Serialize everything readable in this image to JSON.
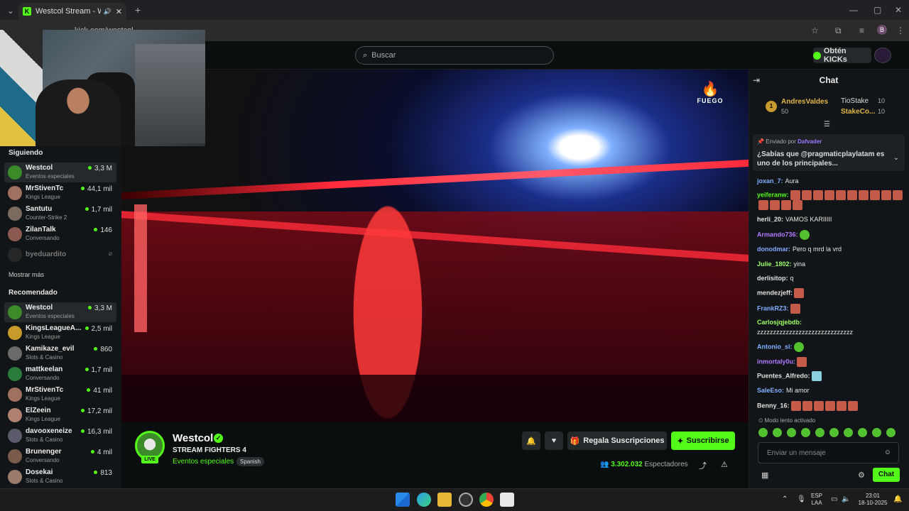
{
  "browser": {
    "tab_title": "Westcol Stream - Watch Li",
    "tab_favicon": "K",
    "url": "kick.com/westcol",
    "profile_initial": "B"
  },
  "header": {
    "search_placeholder": "Buscar",
    "kicks_button": "Obtén KICKs"
  },
  "sidebar": {
    "following_title": "Siguiendo",
    "following": [
      {
        "name": "Westcol",
        "category": "Eventos especiales",
        "viewers": "3,3 M"
      },
      {
        "name": "MrStivenTc",
        "category": "Kings League",
        "viewers": "44,1 mil"
      },
      {
        "name": "Santutu",
        "category": "Counter-Strike 2",
        "viewers": "1,7 mil"
      },
      {
        "name": "ZilanTalk",
        "category": "Conversando",
        "viewers": "146"
      },
      {
        "name": "byeduardito",
        "category": "",
        "viewers": ""
      }
    ],
    "show_more": "Mostrar más",
    "recommended_title": "Recomendado",
    "recommended": [
      {
        "name": "Westcol",
        "category": "Eventos especiales",
        "viewers": "3,3 M"
      },
      {
        "name": "KingsLeagueA...",
        "category": "Kings League",
        "viewers": "2,5 mil"
      },
      {
        "name": "Kamikaze_evil",
        "category": "Slots & Casino",
        "viewers": "860"
      },
      {
        "name": "mattkeelan",
        "category": "Conversando",
        "viewers": "1,7 mil"
      },
      {
        "name": "MrStivenTc",
        "category": "Kings League",
        "viewers": "41 mil"
      },
      {
        "name": "ElZeein",
        "category": "Kings League",
        "viewers": "17,2 mil"
      },
      {
        "name": "davooxeneize",
        "category": "Slots & Casino",
        "viewers": "16,3 mil"
      },
      {
        "name": "Brunenger",
        "category": "Conversando",
        "viewers": "4 mil"
      },
      {
        "name": "Dosekai",
        "category": "Slots & Casino",
        "viewers": "813"
      }
    ]
  },
  "video": {
    "watermark": "FUEGO"
  },
  "stream": {
    "streamer": "Westcol",
    "live_badge": "LIVE",
    "title": "STREAM FIGHTERS 4",
    "category": "Eventos especiales",
    "language": "Spanish",
    "gift_button": "Regala Suscripciones",
    "subscribe_button": "Suscribirse",
    "viewer_count": "3.302.032",
    "viewer_label": "Espectadores"
  },
  "chat": {
    "title": "Chat",
    "leaderboard": [
      {
        "rank": "1",
        "name": "AndresValdes",
        "value": "50"
      },
      {
        "name": "TioStake",
        "value": "10"
      },
      {
        "name": "StakeCo...",
        "value": "10"
      }
    ],
    "pinned_by_label": "Enviado por",
    "pinned_by_user": "Dafvader",
    "pinned_message": "¿Sabías que @pragmaticplaylatam es uno de los principales...",
    "messages": [
      {
        "user": "joxan_7:",
        "text": "Aura",
        "color": "#7fb0ff"
      },
      {
        "user": "yeiferanw:",
        "text": "",
        "color": "#53fc18"
      },
      {
        "user": "herli_20:",
        "text": "VAMOS KARIIIII",
        "color": "#e0e0e0"
      },
      {
        "user": "Armando736:",
        "text": "",
        "color": "#b07bff"
      },
      {
        "user": "donodmar:",
        "text": "Pero q mrd la vrd",
        "color": "#7fa8ff"
      },
      {
        "user": "Julie_1802:",
        "text": "yina",
        "color": "#9bff6a"
      },
      {
        "user": "derlisitop:",
        "text": "q",
        "color": "#e0e0e0"
      },
      {
        "user": "mendezjeff:",
        "text": "",
        "color": "#e0e0e0"
      },
      {
        "user": "FrankRZ3:",
        "text": "",
        "color": "#7fb0ff"
      },
      {
        "user": "Carlosjqjebdb:",
        "text": "",
        "color": "#9bff6a"
      },
      {
        "user": "",
        "text": "zzzzzzzzzzzzzzzzzzzzzzzzzzzzzz",
        "color": "#e0e0e0"
      },
      {
        "user": "Antonio_si:",
        "text": "",
        "color": "#7fb0ff"
      },
      {
        "user": "inmortaly0u:",
        "text": "",
        "color": "#b07bff"
      },
      {
        "user": "Puentes_Alfredo:",
        "text": "",
        "color": "#e0e0e0"
      },
      {
        "user": "SaleEso:",
        "text": "Mi amor",
        "color": "#7fb0ff"
      },
      {
        "user": "Benny_16:",
        "text": "",
        "color": "#e0e0e0"
      }
    ],
    "slow_mode": "Modo lento activado",
    "input_placeholder": "Enviar un mensaje",
    "send_button": "Chat"
  },
  "taskbar": {
    "lang_top": "ESP",
    "lang_bottom": "LAA",
    "time": "23:01",
    "date": "18-10-2025"
  },
  "colors": {
    "accent": "#53fc18",
    "background": "#0b0e0f",
    "sidebar": "#121517"
  }
}
